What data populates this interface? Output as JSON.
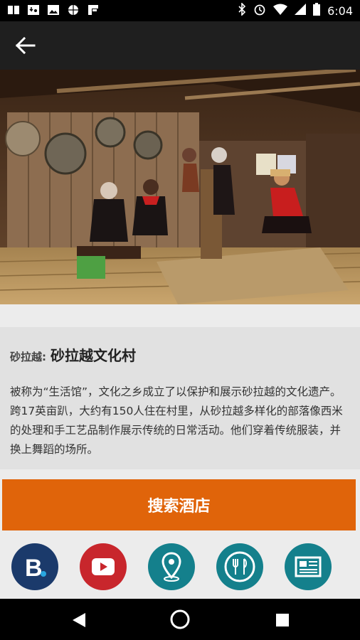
{
  "status_bar": {
    "time": "6:04",
    "left_icons": [
      "book-icon",
      "map-download-icon",
      "image-icon",
      "globe-icon",
      "flipboard-icon"
    ],
    "right_icons": [
      "bluetooth-icon",
      "alarm-icon",
      "wifi-icon",
      "signal-icon",
      "battery-icon"
    ]
  },
  "app_bar": {
    "back_icon": "arrow-left-icon"
  },
  "hero": {
    "description": "Sarawak Cultural Village longhouse interior: women in traditional dress weaving mats and pounding rice, gongs hanging on wooden wall"
  },
  "attraction": {
    "region": "砂拉越:",
    "name": "砂拉越文化村",
    "description": "被称为“生活馆”，文化之乡成立了以保护和展示砂拉越的文化遗产。跨17英亩趴，大约有150人住在村里，从砂拉越多样化的部落像西米的处理和手工艺品制作展示传统的日常活动。他们穿着传统服装，并换上舞蹈的场所。"
  },
  "search_button": {
    "label": "搜索酒店",
    "color": "#e0640a"
  },
  "action_icons": [
    {
      "name": "booking-icon",
      "color": "#1b3a6b"
    },
    {
      "name": "youtube-icon",
      "color": "#c8262c"
    },
    {
      "name": "map-pin-icon",
      "color": "#14808c"
    },
    {
      "name": "restaurant-icon",
      "color": "#14808c"
    },
    {
      "name": "news-icon",
      "color": "#14808c"
    }
  ],
  "nav_bar": {
    "icons": [
      "back-triangle-icon",
      "home-circle-icon",
      "recents-square-icon"
    ]
  }
}
